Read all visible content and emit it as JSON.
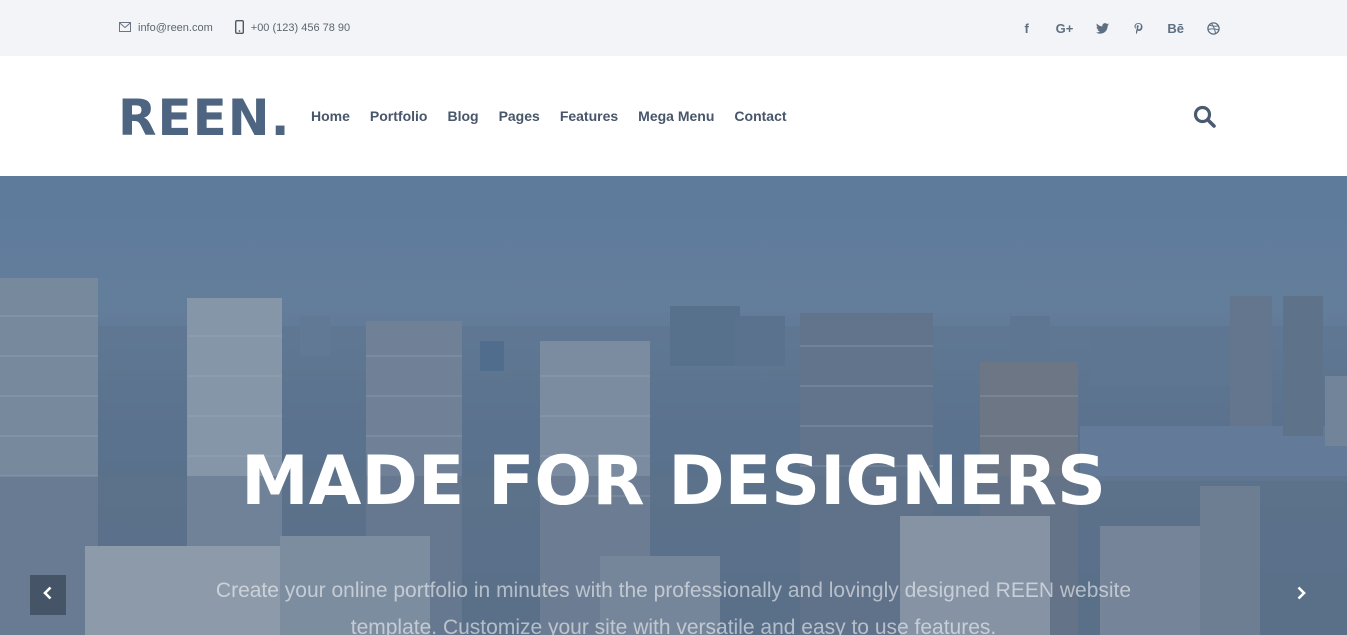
{
  "topbar": {
    "email": "info@reen.com",
    "phone": "+00 (123) 456 78 90",
    "social": [
      "f",
      "G+",
      "t",
      "p",
      "Bē",
      "d"
    ]
  },
  "nav": {
    "logo": "REEN.",
    "menu": [
      "Home",
      "Portfolio",
      "Blog",
      "Pages",
      "Features",
      "Mega Menu",
      "Contact"
    ]
  },
  "hero": {
    "title": "MADE FOR DESIGNERS",
    "subtitle": "Create your online portfolio in minutes with the professionally and lovingly designed REEN website template. Customize your site with versatile and easy to use features."
  },
  "colors": {
    "brand": "#4d6580",
    "topbar_bg": "#f2f4f8",
    "hero_overlay": "#6985a6"
  }
}
